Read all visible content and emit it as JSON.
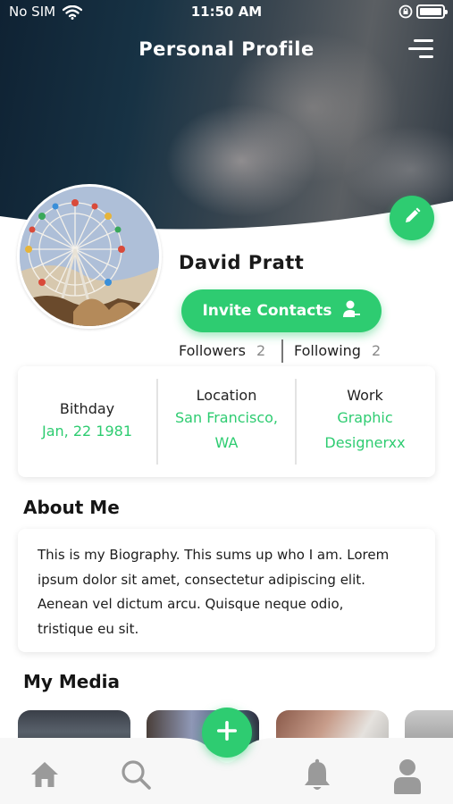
{
  "status_bar": {
    "carrier": "No SIM",
    "time": "11:50 AM"
  },
  "header": {
    "title": "Personal Profile"
  },
  "profile": {
    "name": "David Pratt",
    "invite_label": "Invite Contacts",
    "followers_label": "Followers",
    "followers_count": "2",
    "following_label": "Following",
    "following_count": "2"
  },
  "info": {
    "birthday": {
      "label": "Bithday",
      "value": "Jan, 22 1981"
    },
    "location": {
      "label": "Location",
      "value_line1": "San Francisco,",
      "value_line2": "WA"
    },
    "work": {
      "label": "Work",
      "value_line1": "Graphic",
      "value_line2": "Designerxx"
    }
  },
  "about": {
    "title": "About Me",
    "line1": "This is my Biography. This sums up who I am. Lorem",
    "line2": "ipsum dolor sit amet, consectetur adipiscing elit.",
    "line3": "Aenean vel dictum arcu. Quisque neque odio,",
    "line4": "tristique eu sit."
  },
  "media": {
    "title": "My Media"
  },
  "icons": {
    "wifi": "wifi-icon",
    "orientation_lock": "orientation-lock-icon",
    "battery": "battery-icon",
    "menu": "menu-icon",
    "edit": "pencil-icon",
    "invite": "user-add-icon",
    "home": "home-icon",
    "search": "search-icon",
    "add": "plus-icon",
    "notifications": "bell-icon",
    "profile": "user-icon"
  },
  "colors": {
    "accent": "#2ecc71",
    "header_dark": "#173244",
    "tab_icon": "#9a9a9a"
  }
}
